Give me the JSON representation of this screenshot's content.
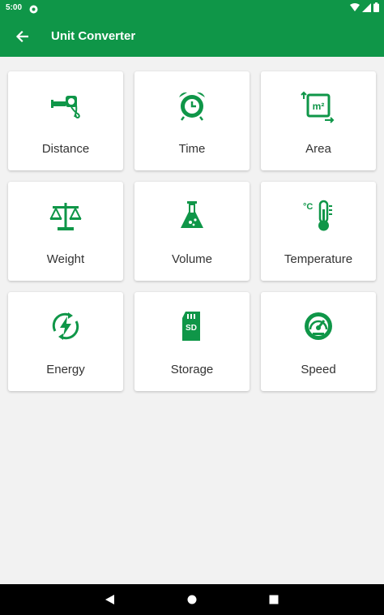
{
  "status": {
    "time": "5:00"
  },
  "app_bar": {
    "title": "Unit Converter",
    "back_icon": "arrow-back-icon"
  },
  "accent_color": "#0f9648",
  "categories": [
    {
      "label": "Distance",
      "icon": "distance-icon"
    },
    {
      "label": "Time",
      "icon": "alarm-clock-icon"
    },
    {
      "label": "Area",
      "icon": "area-icon"
    },
    {
      "label": "Weight",
      "icon": "scale-icon"
    },
    {
      "label": "Volume",
      "icon": "flask-icon"
    },
    {
      "label": "Temperature",
      "icon": "thermometer-icon"
    },
    {
      "label": "Energy",
      "icon": "energy-icon"
    },
    {
      "label": "Storage",
      "icon": "sd-card-icon"
    },
    {
      "label": "Speed",
      "icon": "speedometer-icon"
    }
  ],
  "icon_text": {
    "area": "m²",
    "temperature": "°C",
    "storage": "SD"
  },
  "nav_bar": {
    "back": "nav-back-icon",
    "home": "nav-home-icon",
    "recent": "nav-recent-icon"
  }
}
